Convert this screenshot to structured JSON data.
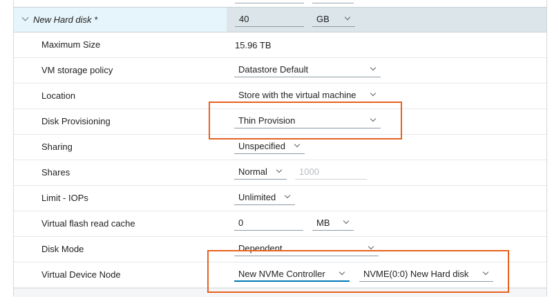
{
  "header": {
    "title": "New Hard disk *",
    "size_value": "40",
    "size_unit": "GB"
  },
  "rows": [
    {
      "label": "Maximum Size",
      "value": "15.96 TB"
    },
    {
      "label": "VM storage policy",
      "value": "Datastore Default"
    },
    {
      "label": "Location",
      "value": "Store with the virtual machine"
    },
    {
      "label": "Disk Provisioning",
      "value": "Thin Provision"
    },
    {
      "label": "Sharing",
      "value": "Unspecified"
    },
    {
      "label": "Shares",
      "value": "Normal",
      "extra": "1000"
    },
    {
      "label": "Limit - IOPs",
      "value": "Unlimited"
    },
    {
      "label": "Virtual flash read cache",
      "value": "0",
      "unit": "MB"
    },
    {
      "label": "Disk Mode",
      "value": "Dependent"
    },
    {
      "label": "Virtual Device Node",
      "value": "New NVMe Controller",
      "extra": "NVME(0:0) New Hard disk"
    }
  ],
  "colors": {
    "highlight": "#e8601c",
    "accent": "#0079b8",
    "header_bg": "#dbe5ea",
    "header_left_bg": "#e6f5fb"
  },
  "icons": [
    "chevron-down-icon"
  ]
}
